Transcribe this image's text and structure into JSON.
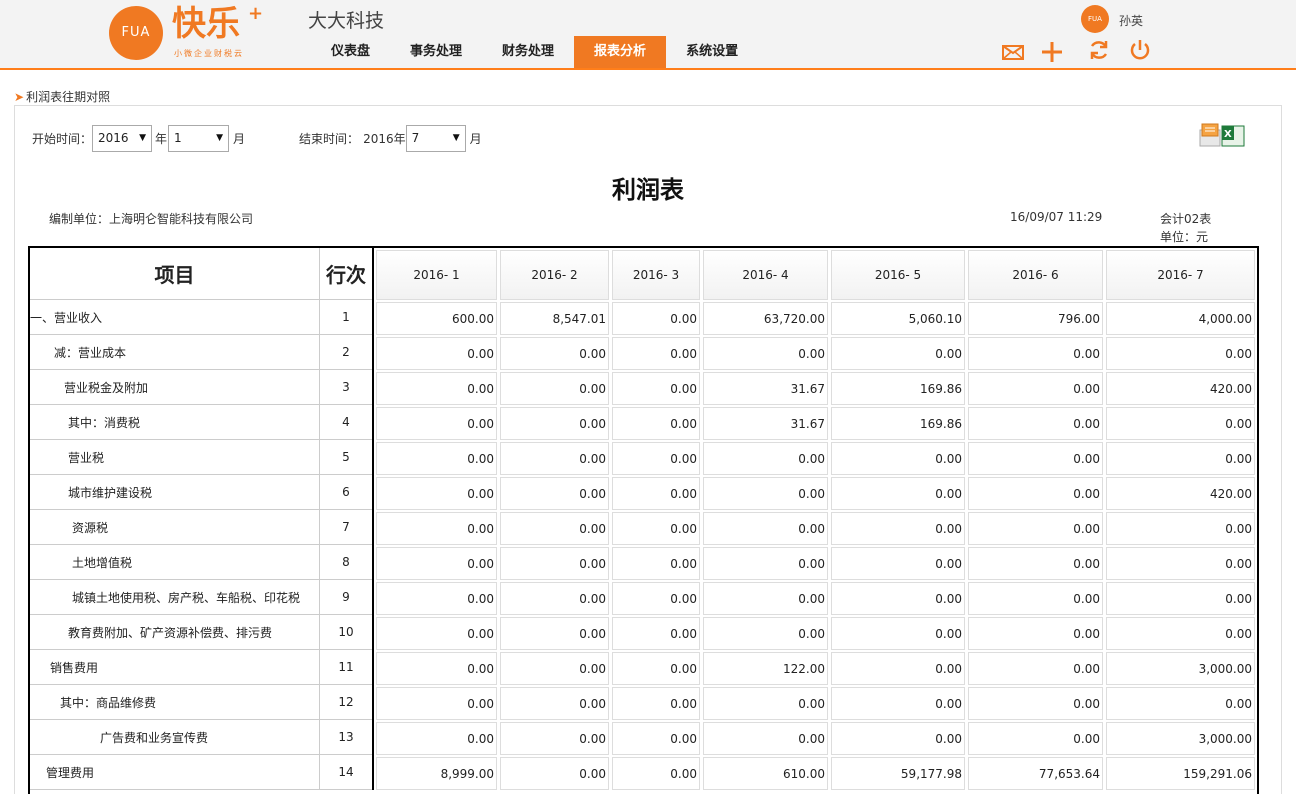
{
  "header": {
    "logo_badge": "FUA",
    "logo_text": "快乐",
    "logo_plus": "+",
    "logo_sub": "小微企业财税云",
    "company": "大大科技",
    "nav": [
      "仪表盘",
      "事务处理",
      "财务处理",
      "报表分析",
      "系统设置"
    ],
    "active_nav": 3,
    "user_badge": "FUA",
    "user_name": "孙英"
  },
  "breadcrumb": "利润表往期对照",
  "filters": {
    "start_label": "开始时间：",
    "start_year": "2016",
    "year_suffix": "年",
    "start_month": "1",
    "month_suffix": "月",
    "end_label": "结束时间：",
    "end_year_text": "2016年",
    "end_month": "7",
    "end_month_suffix": "月"
  },
  "report": {
    "title": "利润表",
    "unit_org": "编制单位：上海明仑智能科技有限公司",
    "date": "16/09/07 11:29",
    "code": "会计02表",
    "unit": "单位：元"
  },
  "table": {
    "head_item": "项目",
    "head_line": "行次",
    "columns": [
      "2016- 1",
      "2016- 2",
      "2016- 3",
      "2016- 4",
      "2016- 5",
      "2016- 6",
      "2016- 7"
    ],
    "rows": [
      {
        "item": "一、营业收入",
        "line": "1",
        "values": [
          "600.00",
          "8,547.01",
          "0.00",
          "63,720.00",
          "5,060.10",
          "796.00",
          "4,000.00"
        ]
      },
      {
        "item": "减：营业成本",
        "line": "2",
        "values": [
          "0.00",
          "0.00",
          "0.00",
          "0.00",
          "0.00",
          "0.00",
          "0.00"
        ]
      },
      {
        "item": "营业税金及附加",
        "line": "3",
        "values": [
          "0.00",
          "0.00",
          "0.00",
          "31.67",
          "169.86",
          "0.00",
          "420.00"
        ]
      },
      {
        "item": "其中：消费税",
        "line": "4",
        "values": [
          "0.00",
          "0.00",
          "0.00",
          "31.67",
          "169.86",
          "0.00",
          "0.00"
        ]
      },
      {
        "item": "营业税",
        "line": "5",
        "values": [
          "0.00",
          "0.00",
          "0.00",
          "0.00",
          "0.00",
          "0.00",
          "0.00"
        ]
      },
      {
        "item": "城市维护建设税",
        "line": "6",
        "values": [
          "0.00",
          "0.00",
          "0.00",
          "0.00",
          "0.00",
          "0.00",
          "420.00"
        ]
      },
      {
        "item": "资源税",
        "line": "7",
        "values": [
          "0.00",
          "0.00",
          "0.00",
          "0.00",
          "0.00",
          "0.00",
          "0.00"
        ]
      },
      {
        "item": "土地增值税",
        "line": "8",
        "values": [
          "0.00",
          "0.00",
          "0.00",
          "0.00",
          "0.00",
          "0.00",
          "0.00"
        ]
      },
      {
        "item": "城镇土地使用税、房产税、车船税、印花税",
        "line": "9",
        "values": [
          "0.00",
          "0.00",
          "0.00",
          "0.00",
          "0.00",
          "0.00",
          "0.00"
        ]
      },
      {
        "item": "教育费附加、矿产资源补偿费、排污费",
        "line": "10",
        "values": [
          "0.00",
          "0.00",
          "0.00",
          "0.00",
          "0.00",
          "0.00",
          "0.00"
        ]
      },
      {
        "item": "销售费用",
        "line": "11",
        "values": [
          "0.00",
          "0.00",
          "0.00",
          "122.00",
          "0.00",
          "0.00",
          "3,000.00"
        ]
      },
      {
        "item": "其中：商品维修费",
        "line": "12",
        "values": [
          "0.00",
          "0.00",
          "0.00",
          "0.00",
          "0.00",
          "0.00",
          "0.00"
        ]
      },
      {
        "item": "广告费和业务宣传费",
        "line": "13",
        "values": [
          "0.00",
          "0.00",
          "0.00",
          "0.00",
          "0.00",
          "0.00",
          "3,000.00"
        ]
      },
      {
        "item": "管理费用",
        "line": "14",
        "values": [
          "8,999.00",
          "0.00",
          "0.00",
          "610.00",
          "59,177.98",
          "77,653.64",
          "159,291.06"
        ]
      }
    ]
  }
}
